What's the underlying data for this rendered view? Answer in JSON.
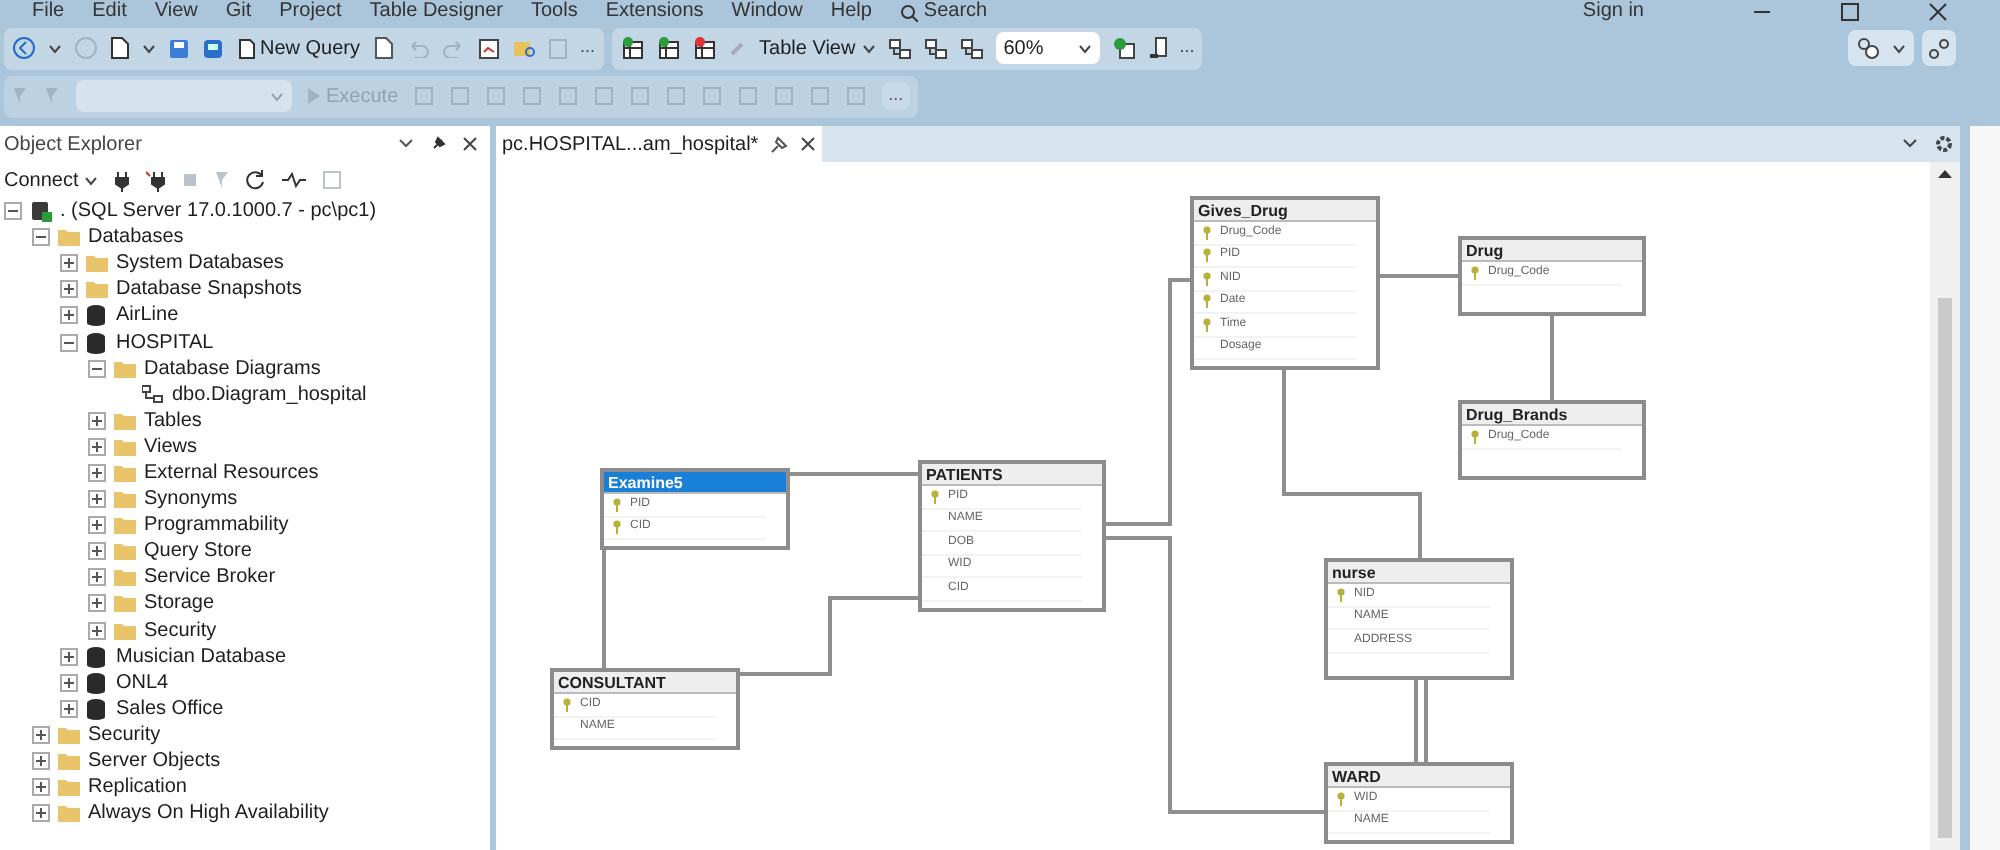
{
  "menu": [
    "File",
    "Edit",
    "View",
    "Git",
    "Project",
    "Table Designer",
    "Tools",
    "Extensions",
    "Window",
    "Help"
  ],
  "search": "Search",
  "sign_in": "Sign in",
  "toolbar": {
    "new_query": "New Query",
    "table_view": "Table View",
    "zoom": "60%",
    "overflow": "...",
    "execute": {
      "label": "Execute",
      "disabled": true
    },
    "overflow_2": "..."
  },
  "object_explorer": {
    "title": "Object Explorer",
    "connect": "Connect",
    "tree": [
      {
        "label": ". (SQL Server 17.0.1000.7 - pc\\pc1)",
        "kind": "server",
        "expanded": true,
        "children": [
          {
            "label": "Databases",
            "kind": "folder",
            "expanded": true,
            "children": [
              {
                "label": "System Databases",
                "kind": "folder",
                "expanded": false
              },
              {
                "label": "Database Snapshots",
                "kind": "folder",
                "expanded": false
              },
              {
                "label": "AirLine",
                "kind": "database",
                "expanded": false
              },
              {
                "label": "HOSPITAL",
                "kind": "database",
                "expanded": true,
                "children": [
                  {
                    "label": "Database Diagrams",
                    "kind": "folder",
                    "expanded": true,
                    "children": [
                      {
                        "label": "dbo.Diagram_hospital",
                        "kind": "diagram"
                      }
                    ]
                  },
                  {
                    "label": "Tables",
                    "kind": "folder",
                    "expanded": false
                  },
                  {
                    "label": "Views",
                    "kind": "folder",
                    "expanded": false
                  },
                  {
                    "label": "External Resources",
                    "kind": "folder",
                    "expanded": false
                  },
                  {
                    "label": "Synonyms",
                    "kind": "folder",
                    "expanded": false
                  },
                  {
                    "label": "Programmability",
                    "kind": "folder",
                    "expanded": false
                  },
                  {
                    "label": "Query Store",
                    "kind": "folder",
                    "expanded": false
                  },
                  {
                    "label": "Service Broker",
                    "kind": "folder",
                    "expanded": false
                  },
                  {
                    "label": "Storage",
                    "kind": "folder",
                    "expanded": false
                  },
                  {
                    "label": "Security",
                    "kind": "folder",
                    "expanded": false
                  }
                ]
              },
              {
                "label": "Musician Database",
                "kind": "database",
                "expanded": false
              },
              {
                "label": "ONL4",
                "kind": "database",
                "expanded": false
              },
              {
                "label": "Sales Office",
                "kind": "database",
                "expanded": false
              }
            ]
          },
          {
            "label": "Security",
            "kind": "folder",
            "expanded": false
          },
          {
            "label": "Server Objects",
            "kind": "folder",
            "expanded": false
          },
          {
            "label": "Replication",
            "kind": "folder",
            "expanded": false
          },
          {
            "label": "Always On High Availability",
            "kind": "folder",
            "expanded": false
          }
        ]
      }
    ]
  },
  "document_tab": {
    "title": "pc.HOSPITAL...am_hospital*",
    "selected": true
  },
  "diagram": {
    "tables": [
      {
        "name": "Gives_Drug",
        "selected": false,
        "columns": [
          {
            "name": "Drug_Code",
            "primary_key": true
          },
          {
            "name": "PID",
            "primary_key": true
          },
          {
            "name": "NID",
            "primary_key": true
          },
          {
            "name": "Date",
            "primary_key": true
          },
          {
            "name": "Time",
            "primary_key": true
          },
          {
            "name": "Dosage",
            "primary_key": false
          }
        ]
      },
      {
        "name": "Drug",
        "selected": false,
        "columns": [
          {
            "name": "Drug_Code",
            "primary_key": true
          }
        ]
      },
      {
        "name": "Drug_Brands",
        "selected": false,
        "columns": [
          {
            "name": "Drug_Code",
            "primary_key": true
          }
        ]
      },
      {
        "name": "Examine5",
        "selected": true,
        "columns": [
          {
            "name": "PID",
            "primary_key": true
          },
          {
            "name": "CID",
            "primary_key": true
          }
        ]
      },
      {
        "name": "PATIENTS",
        "selected": false,
        "columns": [
          {
            "name": "PID",
            "primary_key": true
          },
          {
            "name": "NAME",
            "primary_key": false
          },
          {
            "name": "DOB",
            "primary_key": false
          },
          {
            "name": "WID",
            "primary_key": false
          },
          {
            "name": "CID",
            "primary_key": false
          }
        ]
      },
      {
        "name": "CONSULTANT",
        "selected": false,
        "columns": [
          {
            "name": "CID",
            "primary_key": true
          },
          {
            "name": "NAME",
            "primary_key": false
          }
        ]
      },
      {
        "name": "nurse",
        "selected": false,
        "columns": [
          {
            "name": "NID",
            "primary_key": true
          },
          {
            "name": "NAME",
            "primary_key": false
          },
          {
            "name": "ADDRESS",
            "primary_key": false
          }
        ]
      },
      {
        "name": "WARD",
        "selected": false,
        "columns": [
          {
            "name": "WID",
            "primary_key": true
          },
          {
            "name": "NAME",
            "primary_key": false
          }
        ]
      }
    ]
  }
}
